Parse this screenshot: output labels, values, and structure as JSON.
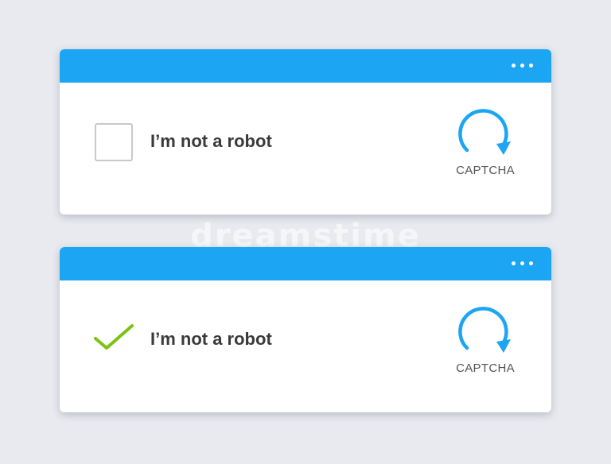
{
  "watermark": "dreamstime",
  "widgets": [
    {
      "label": "I’m not a robot",
      "logo_text": "CAPTCHA",
      "checked": false
    },
    {
      "label": "I’m not a robot",
      "logo_text": "CAPTCHA",
      "checked": true
    }
  ],
  "icons": {
    "menu": "more-dots-icon",
    "logo": "captcha-arrow-icon",
    "check": "checkmark-icon"
  },
  "colors": {
    "background": "#e8eaef",
    "titlebar": "#1ca5f3",
    "captcha_arrow": "#1ca5f3",
    "checkmark": "#7bc313",
    "label_text": "#3a3a3a",
    "checkbox_border": "#c9c9c9"
  }
}
